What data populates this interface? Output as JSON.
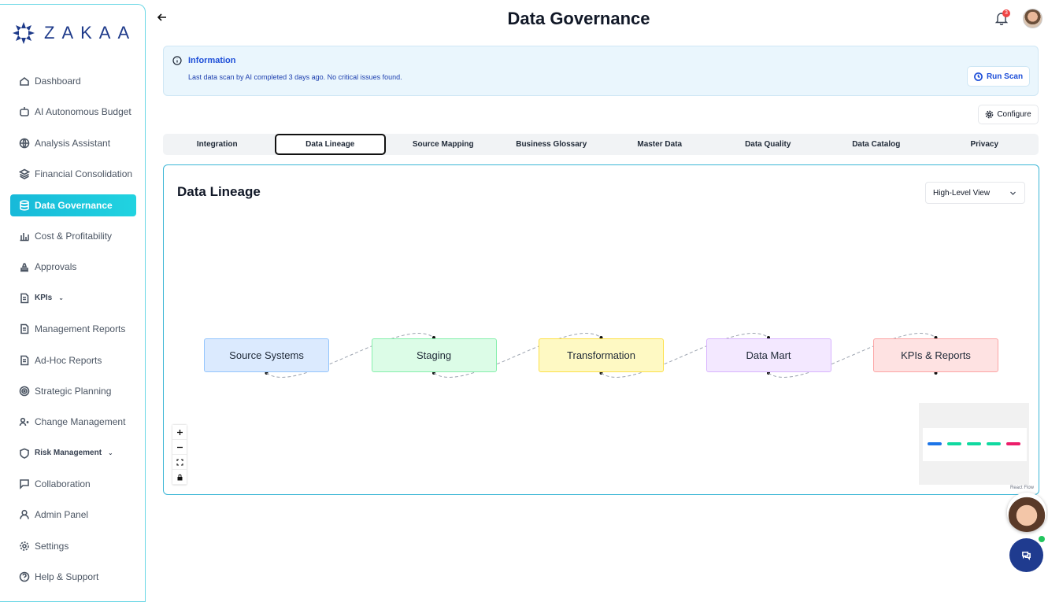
{
  "brand": {
    "name": "ZAKAA",
    "color": "#1e3a8a"
  },
  "sidebar": {
    "items": [
      {
        "label": "Dashboard",
        "icon": "home-icon"
      },
      {
        "label": "AI Autonomous Budget",
        "icon": "robot-icon"
      },
      {
        "label": "Analysis Assistant",
        "icon": "globe-icon"
      },
      {
        "label": "Financial Consolidation",
        "icon": "layers-icon"
      },
      {
        "label": "Data Governance",
        "icon": "database-icon",
        "active": true
      },
      {
        "label": "Cost & Profitability",
        "icon": "bar-chart-icon"
      },
      {
        "label": "Approvals",
        "icon": "stamp-icon"
      },
      {
        "label": "KPIs",
        "icon": "document-icon",
        "dropdown": true
      },
      {
        "label": "Management Reports",
        "icon": "document-icon"
      },
      {
        "label": "Ad-Hoc Reports",
        "icon": "document-icon"
      },
      {
        "label": "Strategic Planning",
        "icon": "target-icon"
      },
      {
        "label": "Change Management",
        "icon": "users-icon"
      },
      {
        "label": "Risk Management",
        "icon": "shield-icon",
        "dropdown": true
      },
      {
        "label": "Collaboration",
        "icon": "message-icon"
      },
      {
        "label": "Admin Panel",
        "icon": "user-icon"
      },
      {
        "label": "Settings",
        "icon": "gear-icon"
      },
      {
        "label": "Help & Support",
        "icon": "help-icon"
      }
    ]
  },
  "header": {
    "title": "Data Governance",
    "notification_count": "3"
  },
  "info": {
    "title": "Information",
    "message": "Last data scan by AI completed 3 days ago. No critical issues found.",
    "run_scan_label": "Run Scan"
  },
  "configure_label": "Configure",
  "tabs": [
    {
      "label": "Integration"
    },
    {
      "label": "Data Lineage",
      "active": true
    },
    {
      "label": "Source Mapping"
    },
    {
      "label": "Business Glossary"
    },
    {
      "label": "Master Data"
    },
    {
      "label": "Data Quality"
    },
    {
      "label": "Data Catalog"
    },
    {
      "label": "Privacy"
    }
  ],
  "lineage": {
    "title": "Data Lineage",
    "view_select": "High-Level View",
    "nodes": [
      {
        "label": "Source Systems",
        "bg": "#dbeafe",
        "border": "#93c5fd",
        "mini": "#1d75e8"
      },
      {
        "label": "Staging",
        "bg": "#dcfce7",
        "border": "#86efac",
        "mini": "#10d9a0"
      },
      {
        "label": "Transformation",
        "bg": "#fef9c3",
        "border": "#fde047",
        "mini": "#10d9a0"
      },
      {
        "label": "Data Mart",
        "bg": "#f3e8ff",
        "border": "#d8b4fe",
        "mini": "#10d9a0"
      },
      {
        "label": "KPIs & Reports",
        "bg": "#fee2e2",
        "border": "#fca5a5",
        "mini": "#ec1e6a"
      }
    ],
    "attribution": "React Flow"
  },
  "colors": {
    "accent": "#21c6dd",
    "active_nav": "#17b9d9",
    "chat_button": "#1f3b8f"
  }
}
